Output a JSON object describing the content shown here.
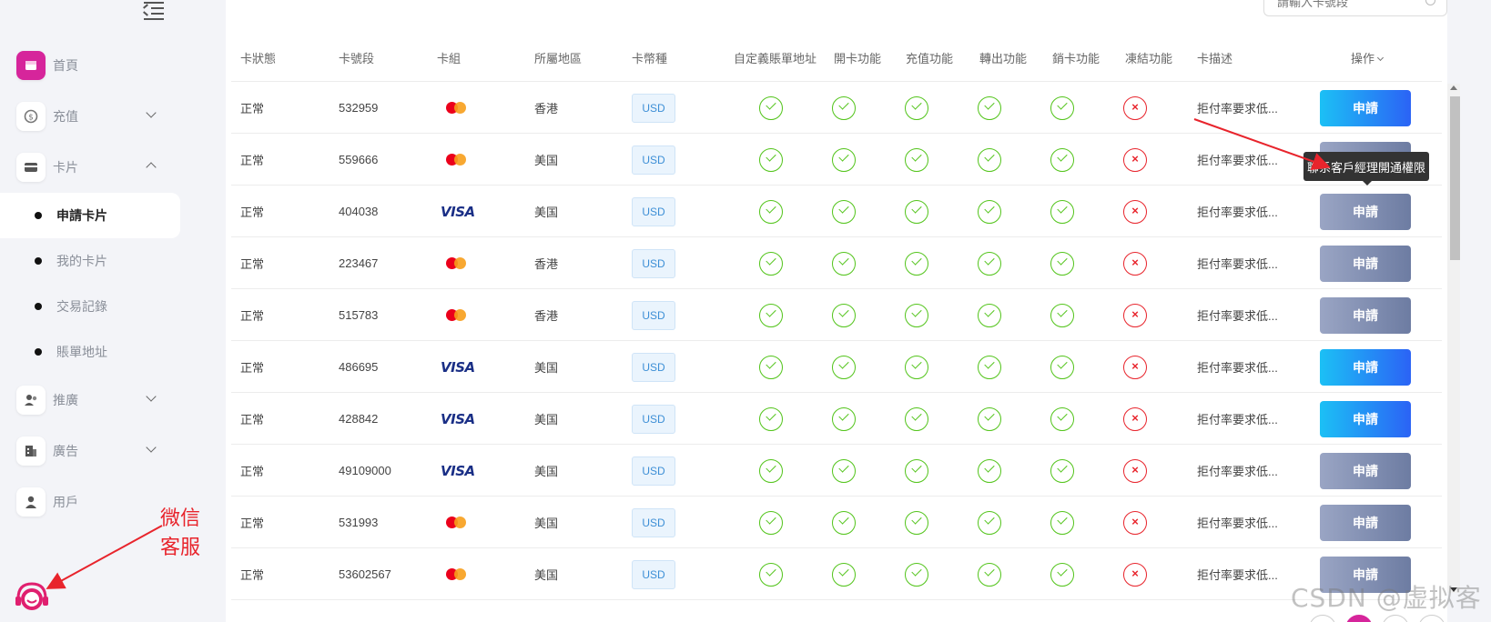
{
  "search": {
    "placeholder": "請輸入卡號段"
  },
  "sidebar": {
    "items": [
      {
        "label": "首頁",
        "icon": "store-icon"
      },
      {
        "label": "充值",
        "icon": "recharge-icon"
      },
      {
        "label": "卡片",
        "icon": "card-icon"
      },
      {
        "label": "推廣",
        "icon": "users-icon"
      },
      {
        "label": "廣告",
        "icon": "building-icon"
      },
      {
        "label": "用戶",
        "icon": "user-icon"
      }
    ],
    "sub_items": [
      {
        "label": "申請卡片"
      },
      {
        "label": "我的卡片"
      },
      {
        "label": "交易記錄"
      },
      {
        "label": "賬單地址"
      }
    ]
  },
  "annotation": {
    "label": "微信客服"
  },
  "table": {
    "headers": [
      "卡狀態",
      "卡號段",
      "卡組",
      "所屬地區",
      "卡幣種",
      "自定義賬單地址",
      "開卡功能",
      "充值功能",
      "轉出功能",
      "銷卡功能",
      "凍結功能",
      "卡描述",
      "操作"
    ],
    "rows": [
      {
        "status": "正常",
        "bin": "532959",
        "brand": "mastercard",
        "region": "香港",
        "currency": "USD",
        "desc": "拒付率要求低...",
        "action": "申請",
        "enabled": true
      },
      {
        "status": "正常",
        "bin": "559666",
        "brand": "mastercard",
        "region": "美国",
        "currency": "USD",
        "desc": "拒付率要求低...",
        "action": "申請",
        "enabled": false
      },
      {
        "status": "正常",
        "bin": "404038",
        "brand": "visa",
        "region": "美国",
        "currency": "USD",
        "desc": "拒付率要求低...",
        "action": "申請",
        "enabled": false
      },
      {
        "status": "正常",
        "bin": "223467",
        "brand": "mastercard",
        "region": "香港",
        "currency": "USD",
        "desc": "拒付率要求低...",
        "action": "申請",
        "enabled": false
      },
      {
        "status": "正常",
        "bin": "515783",
        "brand": "mastercard",
        "region": "香港",
        "currency": "USD",
        "desc": "拒付率要求低...",
        "action": "申請",
        "enabled": false
      },
      {
        "status": "正常",
        "bin": "486695",
        "brand": "visa",
        "region": "美国",
        "currency": "USD",
        "desc": "拒付率要求低...",
        "action": "申請",
        "enabled": true
      },
      {
        "status": "正常",
        "bin": "428842",
        "brand": "visa",
        "region": "美国",
        "currency": "USD",
        "desc": "拒付率要求低...",
        "action": "申請",
        "enabled": true
      },
      {
        "status": "正常",
        "bin": "49109000",
        "brand": "visa",
        "region": "美国",
        "currency": "USD",
        "desc": "拒付率要求低...",
        "action": "申請",
        "enabled": false
      },
      {
        "status": "正常",
        "bin": "531993",
        "brand": "mastercard",
        "region": "美国",
        "currency": "USD",
        "desc": "拒付率要求低...",
        "action": "申請",
        "enabled": false
      },
      {
        "status": "正常",
        "bin": "53602567",
        "brand": "mastercard",
        "region": "美国",
        "currency": "USD",
        "desc": "拒付率要求低...",
        "action": "申請",
        "enabled": false
      }
    ]
  },
  "brand_labels": {
    "visa": "VISA"
  },
  "tooltip": {
    "text": "聯系客戶經理開通權限"
  },
  "watermark": {
    "text": "CSDN @虚拟客"
  },
  "colors": {
    "accent": "#d6259b",
    "check": "#52c41a",
    "cross": "#e8242c",
    "annotation": "#e8242c"
  }
}
